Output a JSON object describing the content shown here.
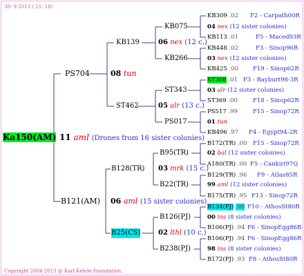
{
  "header": {
    "date": "30-  9-2013 ( 21: 18)"
  },
  "footer": {
    "copyright": "Copyright 2004-2013 @ Karl Kehde Foundation."
  },
  "colors": {
    "frame": "#e8b0d8",
    "lines": "#4a3a9a",
    "code": "#dd0000",
    "note": "#2a2ad0",
    "highlight_green": "#00ee22",
    "highlight_cyan": "#00e8f0"
  },
  "root": {
    "id": "Ka150(AM)",
    "year": "11",
    "code": "aml",
    "note": "(Drones from 16 sister colonies)"
  },
  "l1_top": {
    "id": "PS704",
    "year": "08",
    "code": "tun"
  },
  "l1_bot": {
    "id": "B121(AM)",
    "year": "06",
    "code": "aml",
    "note": "(15 sister colonies)"
  },
  "l2": [
    {
      "id": "KB139",
      "year": "06",
      "code": "nex",
      "note": "(12 c.)"
    },
    {
      "id": "ST462",
      "year": "05",
      "code": "alr",
      "note": "(13 c.)"
    },
    {
      "id": "B128(TR)",
      "year": "03",
      "code": "mrk",
      "note": "(15 c.)"
    },
    {
      "id": "B25(CS)",
      "year": "02",
      "code": "lthl",
      "note": "(10 c.)"
    }
  ],
  "l3": [
    {
      "id": "KB075",
      "year": "04",
      "code": "nex",
      "note": "(12 sister colonies)"
    },
    {
      "id": "KB266",
      "year": "03",
      "code": "nex",
      "note": "(12 sister colonies)"
    },
    {
      "id": "ST343",
      "year": "03",
      "code": "alr",
      "note": "(12 sister colonies)"
    },
    {
      "id": "PS017",
      "year": "01",
      "code": "tun",
      "note": ""
    },
    {
      "id": "B95(TR)",
      "year": "02",
      "code": "bal",
      "note": "(12 sister colonies)"
    },
    {
      "id": "B22(TR)",
      "year": "99",
      "code": "aml",
      "note": "(12 sister colonies)"
    },
    {
      "id": "B126(PJ)",
      "year": "00",
      "code": "ins",
      "note": "(8 sister colonies)"
    },
    {
      "id": "B238(PJ)",
      "year": "98",
      "code": "ins",
      "note": "(8 sister colonies)"
    }
  ],
  "l4": [
    {
      "id": "KB309",
      "year": ".02",
      "origin": "F2 - Carpath00R"
    },
    {
      "id": "KB113",
      "year": ".01",
      "origin": "F5 - Maced93R"
    },
    {
      "id": "KB448",
      "year": ".02",
      "origin": "F3 - Sinop96R"
    },
    {
      "id": "KB425",
      "year": ".00",
      "origin": "F19 - Sinop62R"
    },
    {
      "id": "ST308",
      "year": ".01",
      "origin": "F3 - Bayburt98-3R"
    },
    {
      "id": "ST369",
      "year": ".00",
      "origin": "F18 - Sinop62R"
    },
    {
      "id": "PS517",
      "year": ".99",
      "origin": "F15 - Sinop72R"
    },
    {
      "id": "KB496",
      "year": ".97",
      "origin": "F4 - Egypt94-2R"
    },
    {
      "id": "B172(TR)",
      "year": ".00",
      "origin": "F15 - Sinop72R"
    },
    {
      "id": "A180(TR)",
      "year": ".00",
      "origin": "F5 - Cankiri97Q"
    },
    {
      "id": "B129(TR)",
      "year": ".96",
      "origin": "F9 - Atlas85R"
    },
    {
      "id": "B175(TR)",
      "year": ".95",
      "origin": "F13 - Sinop72R"
    },
    {
      "id": "B134(PJ)",
      "year": ".98",
      "origin": "F10 - AthosSt80R"
    },
    {
      "id": "B106(PJ)",
      "year": ".94",
      "origin": "F6 - SinopEgg86R"
    },
    {
      "id": "B106(PJ)",
      "year": ".94",
      "origin": "F6 - SinopEgg86R"
    },
    {
      "id": "B172(PJ)",
      "year": ".93",
      "origin": "F8 - AthosSt80R"
    }
  ]
}
